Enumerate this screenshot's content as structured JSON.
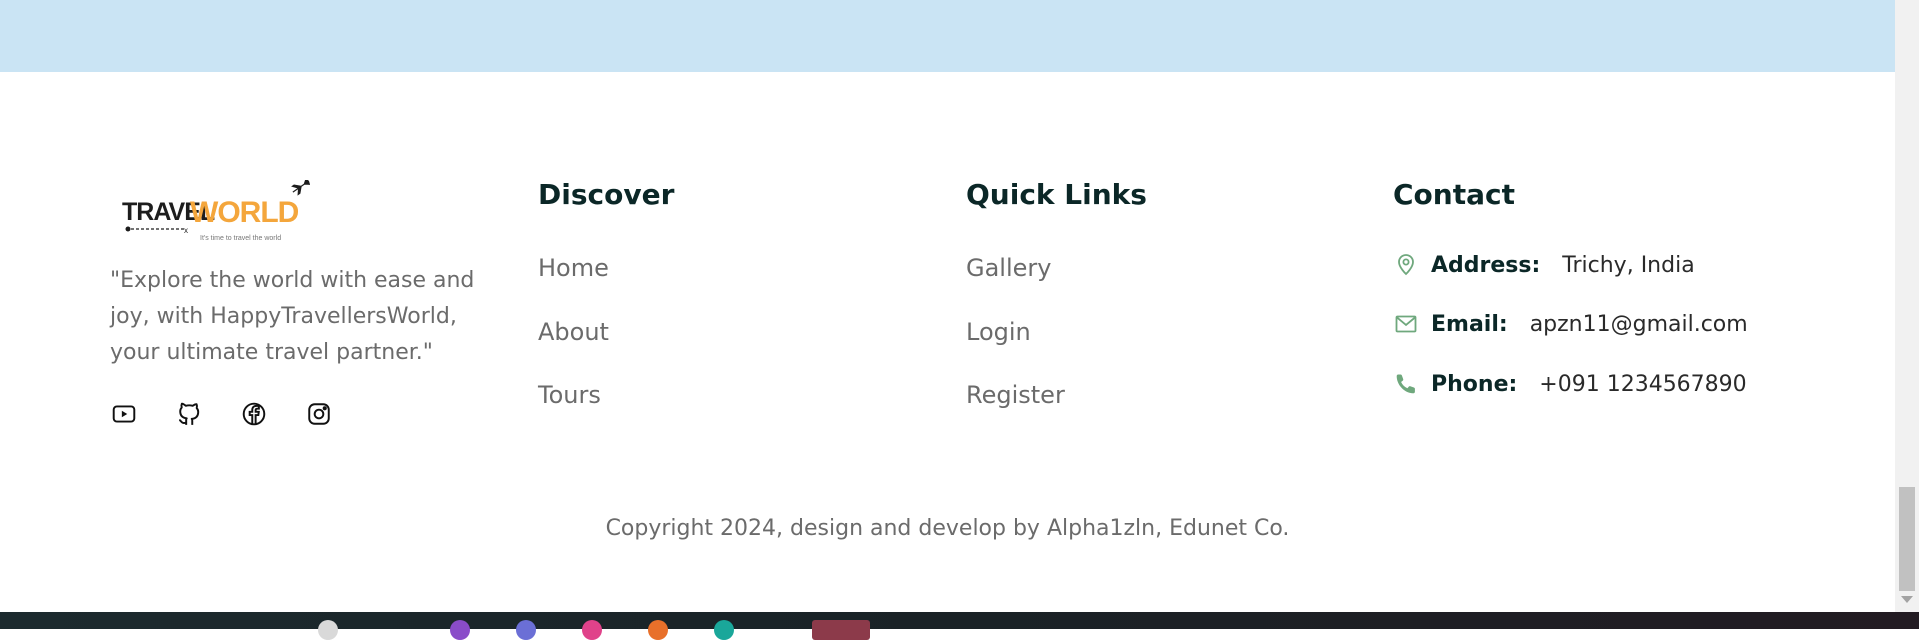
{
  "brand": {
    "logo_text_travel": "TRAVEL",
    "logo_text_world": "WORLD",
    "logo_subtext": "It's time to travel the world",
    "tagline": "\"Explore the world with ease and joy, with HappyTravellersWorld, your ultimate travel partner.\"",
    "socials": [
      {
        "icon": "youtube-icon"
      },
      {
        "icon": "github-icon"
      },
      {
        "icon": "facebook-icon"
      },
      {
        "icon": "instagram-icon"
      }
    ]
  },
  "discover": {
    "title": "Discover",
    "links": [
      "Home",
      "About",
      "Tours"
    ]
  },
  "quick_links": {
    "title": "Quick Links",
    "links": [
      "Gallery",
      "Login",
      "Register"
    ]
  },
  "contact": {
    "title": "Contact",
    "items": [
      {
        "icon": "map-pin-icon",
        "label": "Address:",
        "value": "Trichy, India"
      },
      {
        "icon": "mail-icon",
        "label": "Email:",
        "value": "apzn11@gmail.com"
      },
      {
        "icon": "phone-icon",
        "label": "Phone:",
        "value": "+091 1234567890"
      }
    ]
  },
  "copyright": "Copyright 2024, design and develop by Alpha1zln, Edunet Co.",
  "colors": {
    "top_band": "#cae4f4",
    "heading": "#0b2727",
    "muted_text": "#6b6b6b",
    "icon_green": "#6fa87d",
    "logo_orange": "#f4a63c"
  }
}
